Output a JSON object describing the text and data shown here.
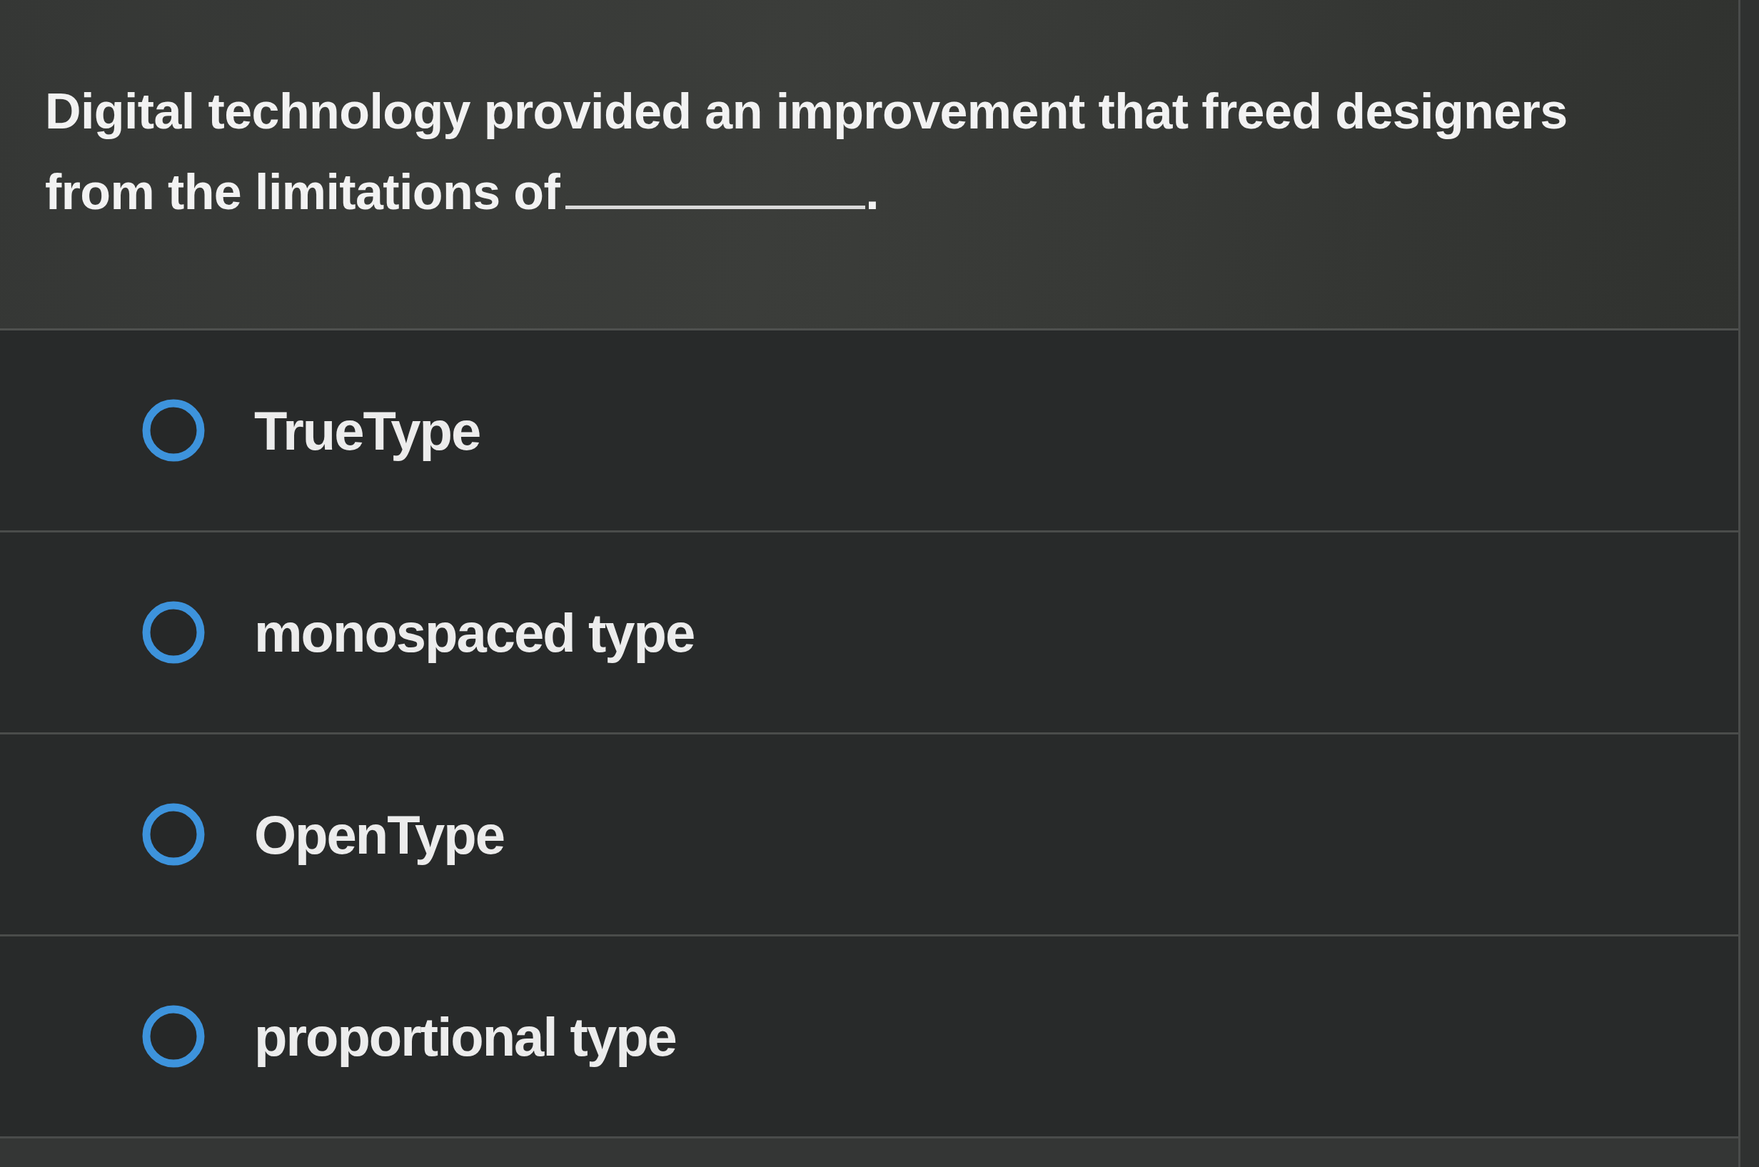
{
  "question": {
    "text": "Digital technology provided an improvement that freed designers from the limitations of",
    "after_blank": "."
  },
  "options": [
    {
      "label": "TrueType",
      "selected": false
    },
    {
      "label": "monospaced type",
      "selected": false
    },
    {
      "label": "OpenType",
      "selected": false
    },
    {
      "label": "proportional type",
      "selected": false
    }
  ]
}
